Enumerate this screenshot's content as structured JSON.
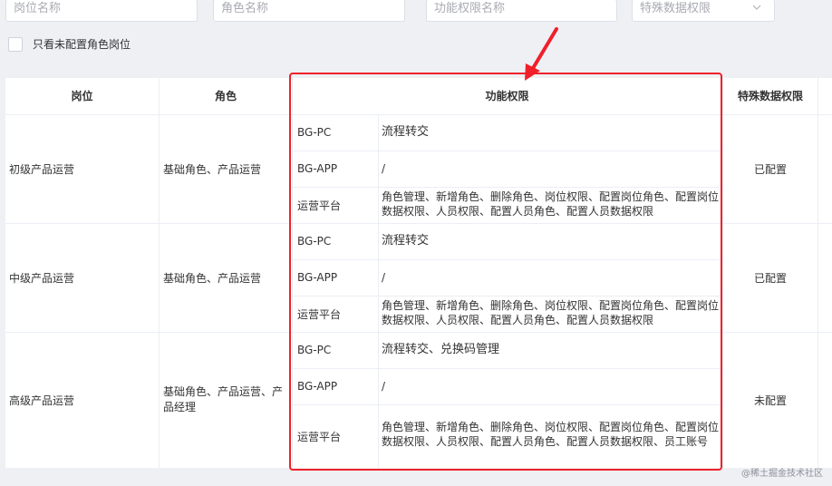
{
  "filters": {
    "position_placeholder": "岗位名称",
    "role_placeholder": "角色名称",
    "func_placeholder": "功能权限名称",
    "special_placeholder": "特殊数据权限"
  },
  "checkbox_label": "只看未配置角色岗位",
  "headers": {
    "position": "岗位",
    "role": "角色",
    "func": "功能权限",
    "special": "特殊数据权限"
  },
  "rows": [
    {
      "position": "初级产品运营",
      "roles": "基础角色、产品运营",
      "perms": [
        {
          "platform": "BG-PC",
          "value": "流程转交"
        },
        {
          "platform": "BG-APP",
          "value": "/"
        },
        {
          "platform": "运营平台",
          "value": "角色管理、新增角色、删除角色、岗位权限、配置岗位角色、配置岗位数据权限、人员权限、配置人员角色、配置人员数据权限"
        }
      ],
      "special": "已配置"
    },
    {
      "position": "中级产品运营",
      "roles": "基础角色、产品运营",
      "perms": [
        {
          "platform": "BG-PC",
          "value": "流程转交"
        },
        {
          "platform": "BG-APP",
          "value": "/"
        },
        {
          "platform": "运营平台",
          "value": "角色管理、新增角色、删除角色、岗位权限、配置岗位角色、配置岗位数据权限、人员权限、配置人员角色、配置人员数据权限"
        }
      ],
      "special": "已配置"
    },
    {
      "position": "高级产品运营",
      "roles": "基础角色、产品运营、产品经理",
      "perms": [
        {
          "platform": "BG-PC",
          "value": "流程转交、兑换码管理"
        },
        {
          "platform": "BG-APP",
          "value": "/"
        },
        {
          "platform": "运营平台",
          "value": "角色管理、新增角色、删除角色、岗位权限、配置岗位角色、配置岗位数据权限、人员权限、配置人员角色、配置人员数据权限、员工账号"
        }
      ],
      "special": "未配置"
    }
  ],
  "watermark": "@稀土掘金技术社区",
  "colors": {
    "highlight": "#f0202a",
    "page_bg": "#eef0f4"
  }
}
